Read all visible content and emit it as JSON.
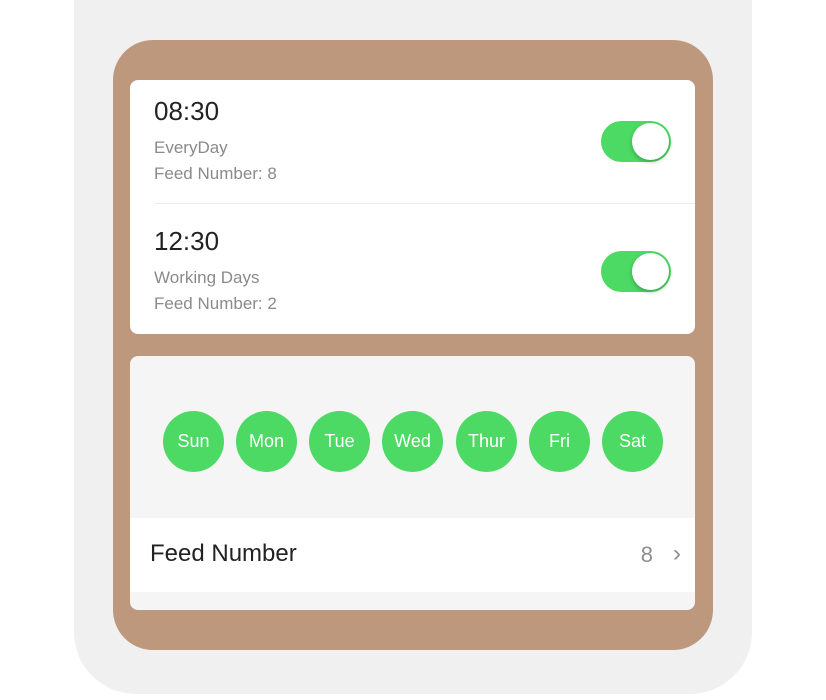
{
  "alarms": [
    {
      "time": "08:30",
      "days": "EveryDay",
      "feed": "Feed Number: 8",
      "enabled": true
    },
    {
      "time": "12:30",
      "days": "Working Days",
      "feed": "Feed Number: 2",
      "enabled": true
    }
  ],
  "days": [
    "Sun",
    "Mon",
    "Tue",
    "Wed",
    "Thur",
    "Fri",
    "Sat"
  ],
  "feed_row": {
    "label": "Feed Number",
    "value": "8",
    "chevron": "›"
  },
  "colors": {
    "accent": "#4cd964",
    "frame": "#be987d"
  }
}
